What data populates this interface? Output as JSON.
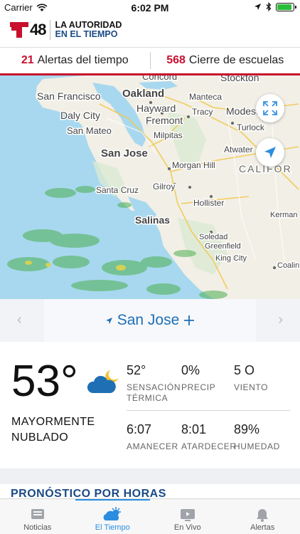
{
  "status_bar": {
    "carrier": "Carrier",
    "time": "6:02 PM",
    "battery_level": 0.95
  },
  "header": {
    "brand_number": "48",
    "tagline_line1": "LA AUTORIDAD",
    "tagline_line2": "EN EL TIEMPO"
  },
  "alerts": {
    "weather_alerts": {
      "count": "21",
      "label": "Alertas del tiempo"
    },
    "school_closings": {
      "count": "568",
      "label": "Cierre de escuelas"
    }
  },
  "map": {
    "labels": {
      "concord": "Concord",
      "stockton": "Stockton",
      "san_francisco": "San Francisco",
      "oakland": "Oakland",
      "manteca": "Manteca",
      "hayward": "Hayward",
      "tracy": "Tracy",
      "modesto": "Modest",
      "daly_city": "Daly City",
      "fremont": "Fremont",
      "turlock": "Turlock",
      "san_mateo": "San Mateo",
      "milpitas": "Milpitas",
      "san_jose": "San Jose",
      "atwater": "Atwater",
      "morgan_hill": "Morgan Hill",
      "california": "CALIFOR",
      "santa_cruz": "Santa Cruz",
      "gilroy": "Gilroy",
      "hollister": "Hollister",
      "kerman": "Kerman",
      "salinas": "Salinas",
      "soledad": "Soledad",
      "greenfield": "Greenfield",
      "king_city": "King City",
      "coalinga": "Coalin"
    }
  },
  "location": {
    "city": "San Jose"
  },
  "current": {
    "temperature": "53°",
    "description_line1": "MAYORMENTE",
    "description_line2": "NUBLADO",
    "feels_like": {
      "value": "52°",
      "label_line1": "SENSACIÓN",
      "label_line2": "TÉRMICA"
    },
    "precip": {
      "value": "0%",
      "label": "PRECIP"
    },
    "wind": {
      "value": "5 O",
      "label": "VIENTO"
    },
    "sunrise": {
      "value": "6:07",
      "label": "AMANECER"
    },
    "sunset": {
      "value": "8:01",
      "label": "ATARDECER"
    },
    "humidity": {
      "value": "89%",
      "label": "HUMEDAD"
    }
  },
  "hourly_title": "PRONÓSTICO POR HORAS",
  "tabs": [
    {
      "label": "Noticias",
      "icon": "news-icon"
    },
    {
      "label": "El Tiempo",
      "icon": "weather-icon"
    },
    {
      "label": "En Vivo",
      "icon": "live-tv-icon"
    },
    {
      "label": "Alertas",
      "icon": "bell-icon"
    }
  ],
  "colors": {
    "brand_red": "#c8102e",
    "brand_blue": "#1a4a86",
    "accent": "#2a8de0",
    "water": "#a8d8ef",
    "land": "#f2efe6"
  }
}
